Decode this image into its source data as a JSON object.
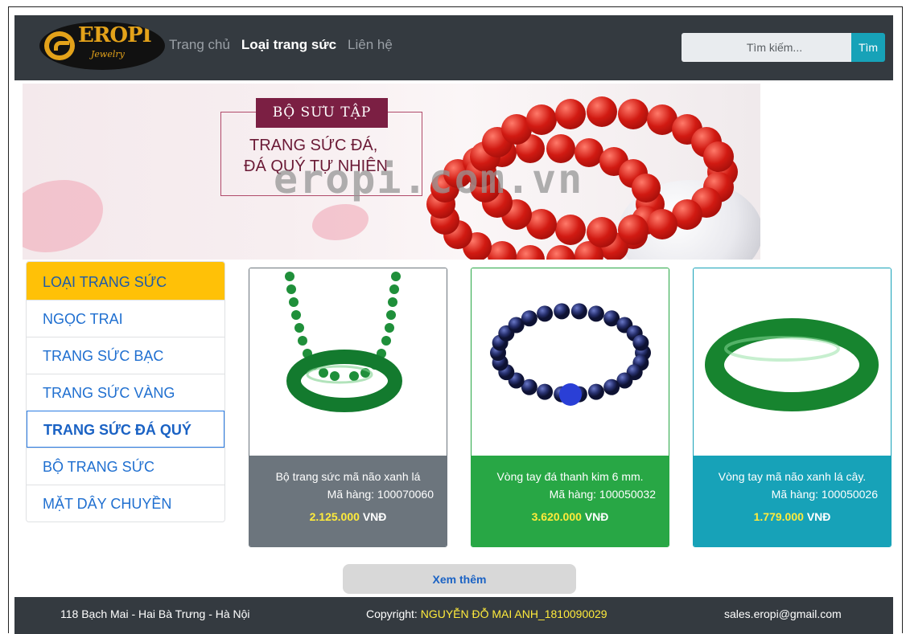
{
  "brand": {
    "logo_text": "EROPI",
    "logo_sub": "Jewelry"
  },
  "nav": {
    "links": [
      "Trang chủ",
      "Loại trang sức",
      "Liên hệ"
    ],
    "active_index": 1
  },
  "search": {
    "placeholder": "Tìm kiếm...",
    "button_label": "Tìm"
  },
  "banner": {
    "tag": "BỘ SƯU TẬP",
    "line1": "TRANG SỨC ĐÁ,",
    "line2": "ĐÁ QUÝ TỰ NHIÊN",
    "watermark": "eropi.com.vn"
  },
  "sidebar": {
    "heading": "LOẠI TRANG SỨC",
    "items": [
      "NGỌC TRAI",
      "TRANG SỨC BẠC",
      "TRANG SỨC VÀNG",
      "TRANG SỨC ĐÁ QUÝ",
      "BỘ TRANG SỨC",
      "MẶT DÂY CHUYỀN"
    ],
    "active_index": 3
  },
  "products": [
    {
      "name": "Bộ trang sức mã não xanh lá",
      "code": "Mã hàng: 100070060",
      "price": "2.125.000",
      "currency": "VNĐ",
      "color": "#6c757d"
    },
    {
      "name": "Vòng tay đá thanh kim 6 mm.",
      "code": "Mã hàng: 100050032",
      "price": "3.620.000",
      "currency": "VNĐ",
      "color": "#28a745"
    },
    {
      "name": "Vòng tay mã não xanh lá cây.",
      "code": "Mã hàng: 100050026",
      "price": "1.779.000",
      "currency": "VNĐ",
      "color": "#17a2b8"
    }
  ],
  "more_button": "Xem thêm",
  "footer": {
    "address": "118 Bạch Mai - Hai Bà Trưng - Hà Nội",
    "copyright_label": "Copyright: ",
    "copyright_name": "NGUYỄN ĐỖ MAI ANH_1810090029",
    "email": "sales.eropi@gmail.com"
  },
  "colors": {
    "navbar": "#343a40",
    "accent_info": "#17a2b8",
    "sidebar_head": "#ffc107",
    "link": "#1f6fd0",
    "price": "#ffeb3b"
  }
}
